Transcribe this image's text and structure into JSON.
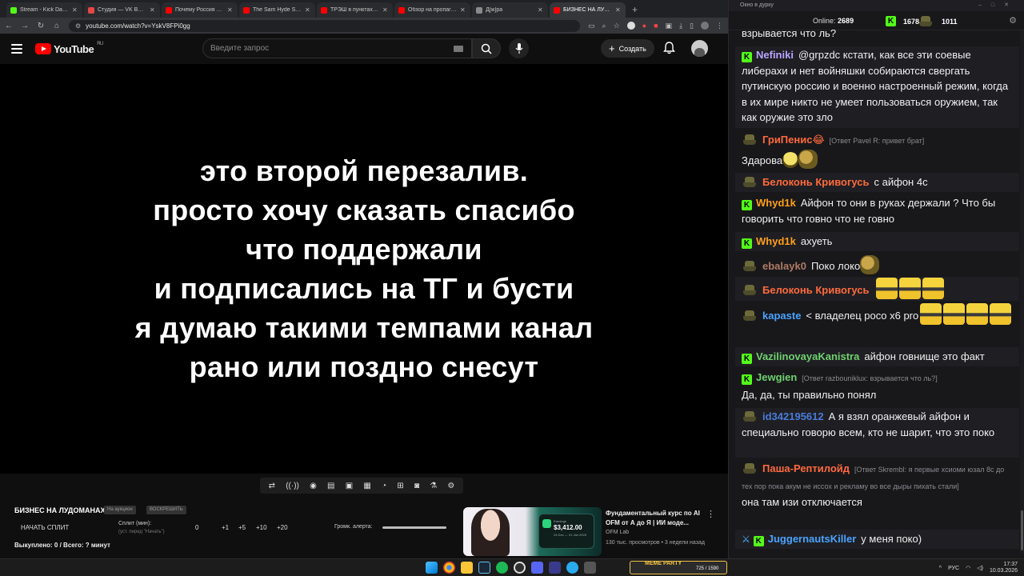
{
  "browser": {
    "tabs": [
      {
        "title": "Stream - Kick Dashboard",
        "color": "#53fc18"
      },
      {
        "title": "Студия — VK Видео Live",
        "color": "#e64646"
      },
      {
        "title": "Почему Россия не дает...",
        "color": "#ff0000"
      },
      {
        "title": "The Sam Hyde Show D...",
        "color": "#ff0000"
      },
      {
        "title": "ТРЭШ в пунктах выдачи",
        "color": "#ff0000"
      },
      {
        "title": "Обзор на пропаганду...",
        "color": "#ff0000"
      },
      {
        "title": "Д[ж]ра",
        "color": "#8a8a8a"
      },
      {
        "title": "БИЗНЕС НА ЛУДОМАНАХ",
        "color": "#ff0000"
      }
    ],
    "url": "youtube.com/watch?v=YskV8FPi0gg",
    "window_controls": [
      "–",
      "□",
      "✕"
    ]
  },
  "youtube": {
    "logo": "YouTube",
    "region": "RU",
    "search_placeholder": "Введите запрос",
    "create_label": "Создать"
  },
  "video": {
    "overlay_lines": [
      "это второй перезалив.",
      "просто хочу сказать спасибо",
      "что поддержали",
      "и подписались на ТГ и бусти",
      "я думаю такими темпами канал",
      "рано или поздно снесут"
    ]
  },
  "panel": {
    "title": "БИЗНЕС НА ЛУДОМАНАХ",
    "pill1": "На аукцион",
    "pill2": "ВОСКРЕШИТЬ",
    "start_split": "НАЧАТЬ СПЛИТ",
    "split_label": "Сплит (мин):",
    "split_sub": "(уст. перед \"Начать\")",
    "split_value": "0",
    "increments": [
      "+1",
      "+5",
      "+10",
      "+20"
    ],
    "alert_label": "Громк. алерта:",
    "bought": "Выкуплено: 0 / Всего: ? минут"
  },
  "recommended": {
    "title": "Фундаментальный курс по AI OFM от А до Я | ИИ моде...",
    "channel": "OFM Lab",
    "meta": "130 тыс. просмотров • 3 недели назад",
    "card_label": "Earnings",
    "card_amount": "$3,412.00",
    "card_date": "24 Dec — 01 Jan 2025"
  },
  "chat": {
    "window_title": "Окно в дурку",
    "online_label": "Online:",
    "online_count": "2689",
    "kick_count": "1678",
    "vk_count": "1011",
    "messages": [
      {
        "badge": "none",
        "user": "",
        "color": "#efeff1",
        "reply": "",
        "text": "взрывается что ль?"
      },
      {
        "badge": "kick",
        "user": "Nefiniki",
        "color": "#b9a4ff",
        "reply": "",
        "text": "@grpzdc кстати, как все эти соевые либерахи и нет войняшки собираются свергать путинскую россию и военно настроенный режим, когда в их мире никто не умеет пользоваться оружием, так как оружие это зло"
      },
      {
        "badge": "vk",
        "user": "ГриПенис😂",
        "color": "#ff6a3d",
        "reply": "[Ответ Pavel R: привет брат]",
        "text": "Здарова"
      },
      {
        "badge": "vk",
        "user": "Белоконь Кривогусь",
        "color": "#ff6a3d",
        "reply": "",
        "text": "с айфон 4с"
      },
      {
        "badge": "kick",
        "user": "Whyd1k",
        "color": "#ff9f1a",
        "reply": "",
        "text": "Айфон то они в руках держали ? Что бы говорить что говно что не говно"
      },
      {
        "badge": "kick",
        "user": "Whyd1k",
        "color": "#ff9f1a",
        "reply": "",
        "text": "ахуеть"
      },
      {
        "badge": "vk",
        "user": "ebalayk0",
        "color": "#b07a66",
        "reply": "",
        "text": "Поко локо"
      },
      {
        "badge": "vk",
        "user": "Белоконь Кривогусь",
        "color": "#ff6a3d",
        "reply": "",
        "text": ""
      },
      {
        "badge": "vk",
        "user": "kapaste",
        "color": "#4aa3ff",
        "reply": "",
        "text": "< владелец poco x6 pro"
      },
      {
        "badge": "kick",
        "user": "VazilinovayaKanistra",
        "color": "#6fd16f",
        "reply": "",
        "text": "айфон говнище это факт"
      },
      {
        "badge": "kick",
        "user": "Jewgien",
        "color": "#6fd16f",
        "reply": "[Ответ razbouniklux: взрывается что ль?]",
        "text": "Да, да, ты правильно понял"
      },
      {
        "badge": "vk",
        "user": "id342195612",
        "color": "#4a7bd9",
        "reply": "",
        "text": "А я взял оранжевый айфон и специально говорю всем, кто не шарит, что это поко"
      },
      {
        "badge": "vk",
        "user": "Паша-Рептилойд",
        "color": "#ff6a3d",
        "reply": "[Ответ Skrembl: я первые хсиоми юзал 8с до тех пор пока акум не иссох и рекламу во все дыры пихать стали]",
        "text": "она там изи отключается"
      },
      {
        "badge": "kick",
        "user": "JuggernautsKiller",
        "color": "#4aa3ff",
        "reply": "",
        "text": "у меня поко)"
      }
    ]
  },
  "taskbar": {
    "game_label": "MEME PARTY",
    "game_stats": "725 / 1590",
    "lang": "РУС",
    "time": "17:37",
    "date": "10.03.2026"
  }
}
